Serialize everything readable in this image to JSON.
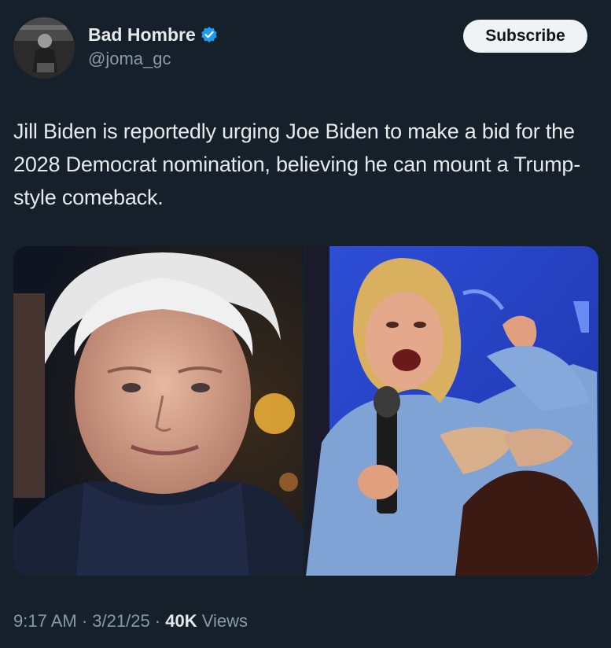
{
  "author": {
    "display_name": "Bad Hombre",
    "handle": "@joma_gc",
    "verified_icon": "verified-badge-icon",
    "verified_color": "#1d9bf0"
  },
  "actions": {
    "subscribe_label": "Subscribe"
  },
  "tweet": {
    "text": "Jill Biden is reportedly urging Joe Biden to make a bid for the 2028 Democrat nomination, believing he can mount a Trump-style comeback."
  },
  "media": {
    "count": 2
  },
  "meta": {
    "time": "9:17 AM",
    "sep1": " · ",
    "date": "3/21/25",
    "sep2": " · ",
    "views_count": "40K",
    "views_label": " Views"
  },
  "colors": {
    "background": "#15202b",
    "text_primary": "#e7e9ea",
    "text_secondary": "#8b98a5",
    "button_bg": "#eff3f4"
  }
}
